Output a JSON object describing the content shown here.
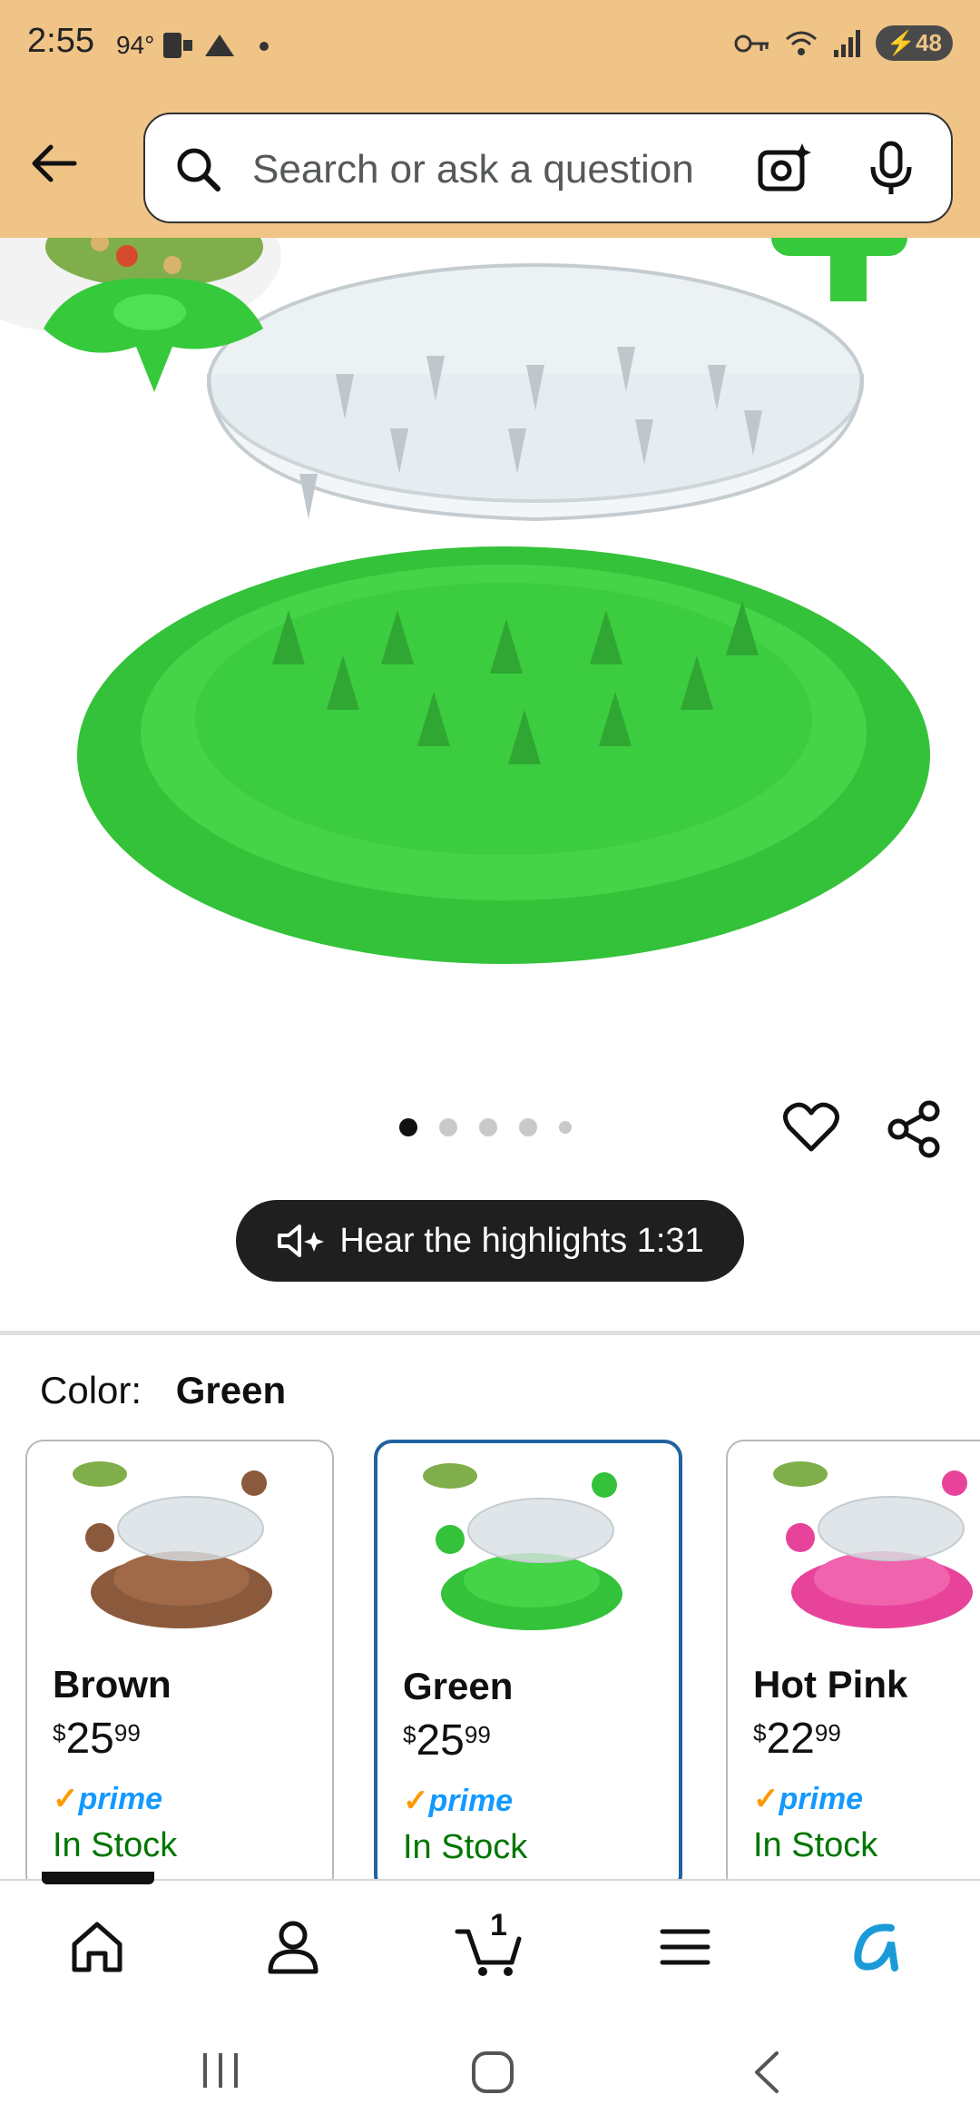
{
  "status_bar": {
    "time": "2:55",
    "temp": "94°",
    "signal_label": "6",
    "battery": "48"
  },
  "search": {
    "placeholder": "Search or ask a question"
  },
  "product_image": {
    "alt": "Green chicken shredder product",
    "dots_total": 5,
    "dot_active_index": 0
  },
  "hear_highlights": {
    "label": "Hear the highlights 1:31"
  },
  "color": {
    "label": "Color:",
    "value": "Green"
  },
  "variants": [
    {
      "name": "Brown",
      "price_currency": "$",
      "price_whole": "25",
      "price_cents": "99",
      "prime_label": "prime",
      "stock": "In Stock",
      "color": "#8b5a3c"
    },
    {
      "name": "Green",
      "price_currency": "$",
      "price_whole": "25",
      "price_cents": "99",
      "prime_label": "prime",
      "stock": "In Stock",
      "color": "#3ec83e"
    },
    {
      "name": "Hot Pink",
      "price_currency": "$",
      "price_whole": "22",
      "price_cents": "99",
      "prime_label": "prime",
      "stock": "In Stock",
      "color": "#e8439a"
    }
  ],
  "bottom_nav": {
    "cart_count": "1"
  },
  "colors": {
    "header_bg": "#f0c387",
    "selected_border": "#2162a1",
    "prime_blue": "#1399ff",
    "in_stock_green": "#007600"
  }
}
